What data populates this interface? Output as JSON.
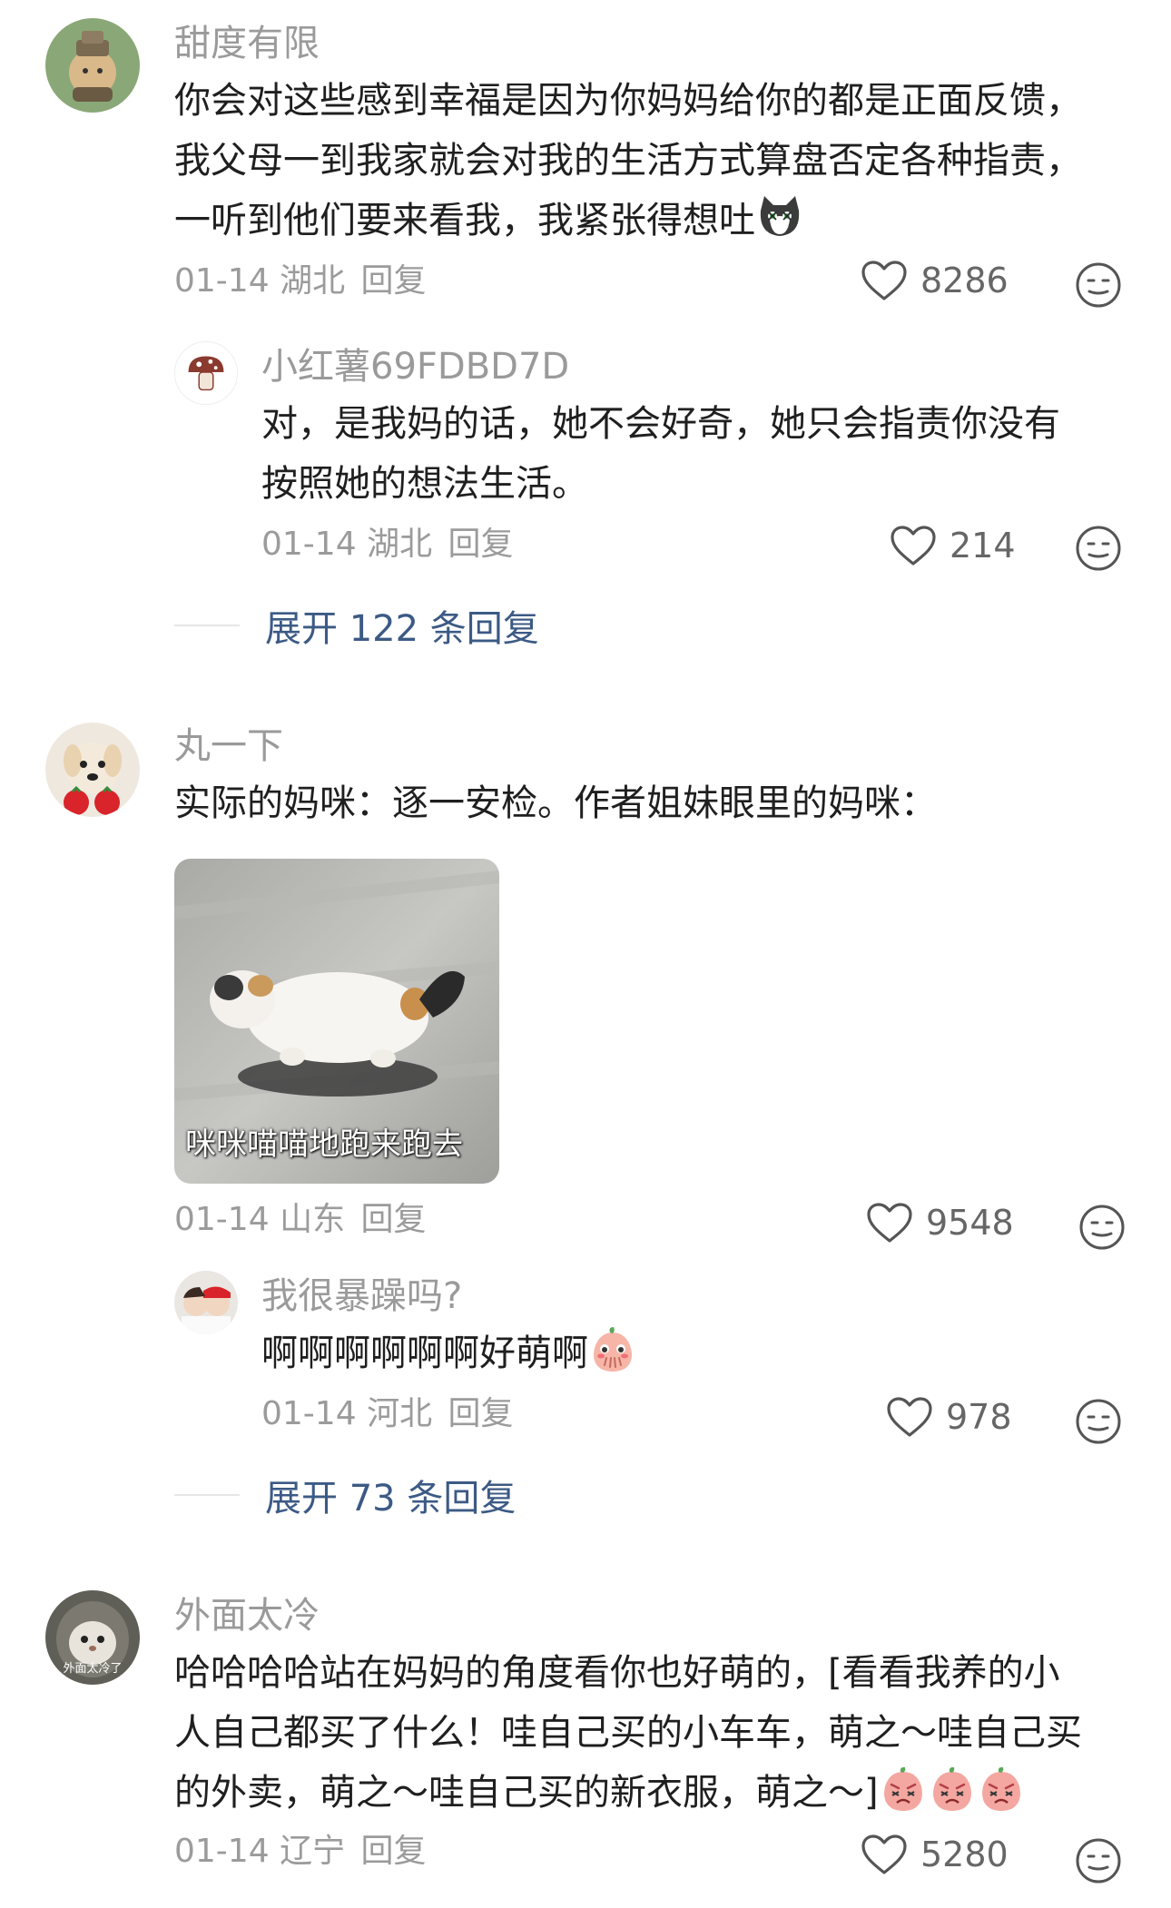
{
  "comments": [
    {
      "username": "甜度有限",
      "lines": [
        "你会对这些感到幸福是因为你妈妈给你的都是正面反馈，",
        "我父母一到我家就会对我的生活方式算盘否定各种指责，",
        "一听到他们要来看我，我紧张得想吐"
      ],
      "date": "01-14",
      "location": "湖北",
      "reply_label": "回复",
      "likes": "8286",
      "reply": {
        "username": "小红薯69FDBD7D",
        "lines": [
          "对，是我妈的话，她不会好奇，她只会指责你没有",
          "按照她的想法生活。"
        ],
        "date": "01-14",
        "location": "湖北",
        "reply_label": "回复",
        "likes": "214"
      },
      "expand_label": "展开 122 条回复"
    },
    {
      "username": "丸一下",
      "lines": [
        "实际的妈咪：逐一安检。作者姐妹眼里的妈咪："
      ],
      "image_caption": "咪咪喵喵地跑来跑去",
      "date": "01-14",
      "location": "山东",
      "reply_label": "回复",
      "likes": "9548",
      "reply": {
        "username": "我很暴躁吗?",
        "lines": [
          "啊啊啊啊啊啊好萌啊"
        ],
        "date": "01-14",
        "location": "河北",
        "reply_label": "回复",
        "likes": "978"
      },
      "expand_label": "展开 73 条回复"
    },
    {
      "username": "外面太冷",
      "avatar_text": "外面太冷了",
      "lines": [
        "哈哈哈哈站在妈妈的角度看你也好萌的，[看看我养的小",
        "人自己都买了什么！哇自己买的小车车，萌之～哇自己买",
        "的外卖，萌之～哇自己买的新衣服，萌之～]"
      ],
      "date": "01-14",
      "location": "辽宁",
      "reply_label": "回复",
      "likes": "5280"
    }
  ],
  "colors": {
    "username": "#9a9a9a",
    "body": "#1f1f1f",
    "meta": "#9b9b9b",
    "expand": "#3c5a85"
  }
}
